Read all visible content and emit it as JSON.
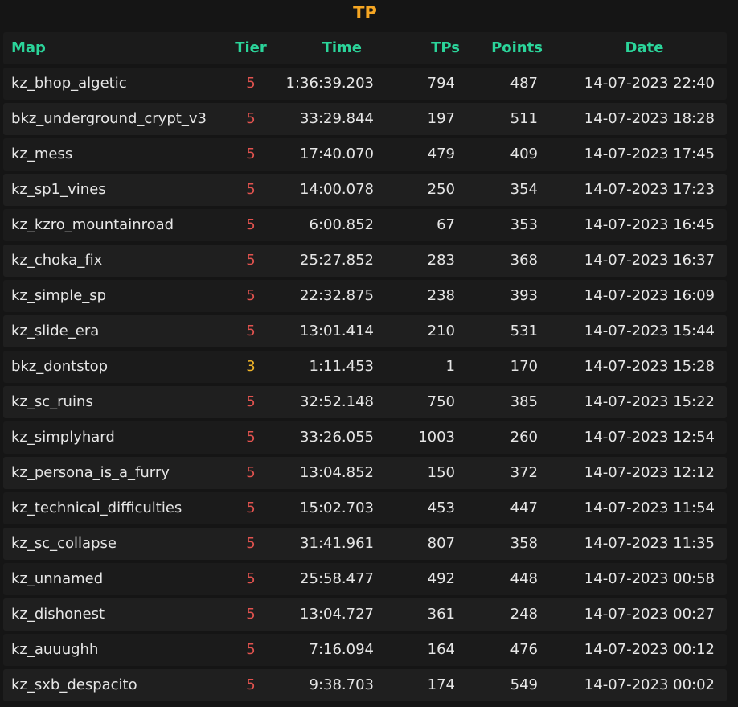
{
  "page": {
    "title": "TP",
    "colors": {
      "title": "#f5a623",
      "header": "#2bd49a",
      "tier_5": "#e2534f",
      "tier_3": "#f0b429",
      "background": "#151515"
    }
  },
  "table": {
    "headers": {
      "map": "Map",
      "tier": "Tier",
      "time": "Time",
      "tps": "TPs",
      "points": "Points",
      "date": "Date"
    },
    "rows": [
      {
        "map": "kz_bhop_algetic",
        "tier": "5",
        "time": "1:36:39.203",
        "tps": "794",
        "points": "487",
        "date": "14-07-2023 22:40"
      },
      {
        "map": "bkz_underground_crypt_v3",
        "tier": "5",
        "time": "33:29.844",
        "tps": "197",
        "points": "511",
        "date": "14-07-2023 18:28"
      },
      {
        "map": "kz_mess",
        "tier": "5",
        "time": "17:40.070",
        "tps": "479",
        "points": "409",
        "date": "14-07-2023 17:45"
      },
      {
        "map": "kz_sp1_vines",
        "tier": "5",
        "time": "14:00.078",
        "tps": "250",
        "points": "354",
        "date": "14-07-2023 17:23"
      },
      {
        "map": "kz_kzro_mountainroad",
        "tier": "5",
        "time": "6:00.852",
        "tps": "67",
        "points": "353",
        "date": "14-07-2023 16:45"
      },
      {
        "map": "kz_choka_fix",
        "tier": "5",
        "time": "25:27.852",
        "tps": "283",
        "points": "368",
        "date": "14-07-2023 16:37"
      },
      {
        "map": "kz_simple_sp",
        "tier": "5",
        "time": "22:32.875",
        "tps": "238",
        "points": "393",
        "date": "14-07-2023 16:09"
      },
      {
        "map": "kz_slide_era",
        "tier": "5",
        "time": "13:01.414",
        "tps": "210",
        "points": "531",
        "date": "14-07-2023 15:44"
      },
      {
        "map": "bkz_dontstop",
        "tier": "3",
        "time": "1:11.453",
        "tps": "1",
        "points": "170",
        "date": "14-07-2023 15:28"
      },
      {
        "map": "kz_sc_ruins",
        "tier": "5",
        "time": "32:52.148",
        "tps": "750",
        "points": "385",
        "date": "14-07-2023 15:22"
      },
      {
        "map": "kz_simplyhard",
        "tier": "5",
        "time": "33:26.055",
        "tps": "1003",
        "points": "260",
        "date": "14-07-2023 12:54"
      },
      {
        "map": "kz_persona_is_a_furry",
        "tier": "5",
        "time": "13:04.852",
        "tps": "150",
        "points": "372",
        "date": "14-07-2023 12:12"
      },
      {
        "map": "kz_technical_difficulties",
        "tier": "5",
        "time": "15:02.703",
        "tps": "453",
        "points": "447",
        "date": "14-07-2023 11:54"
      },
      {
        "map": "kz_sc_collapse",
        "tier": "5",
        "time": "31:41.961",
        "tps": "807",
        "points": "358",
        "date": "14-07-2023 11:35"
      },
      {
        "map": "kz_unnamed",
        "tier": "5",
        "time": "25:58.477",
        "tps": "492",
        "points": "448",
        "date": "14-07-2023 00:58"
      },
      {
        "map": "kz_dishonest",
        "tier": "5",
        "time": "13:04.727",
        "tps": "361",
        "points": "248",
        "date": "14-07-2023 00:27"
      },
      {
        "map": "kz_auuughh",
        "tier": "5",
        "time": "7:16.094",
        "tps": "164",
        "points": "476",
        "date": "14-07-2023 00:12"
      },
      {
        "map": "kz_sxb_despacito",
        "tier": "5",
        "time": "9:38.703",
        "tps": "174",
        "points": "549",
        "date": "14-07-2023 00:02"
      }
    ]
  }
}
